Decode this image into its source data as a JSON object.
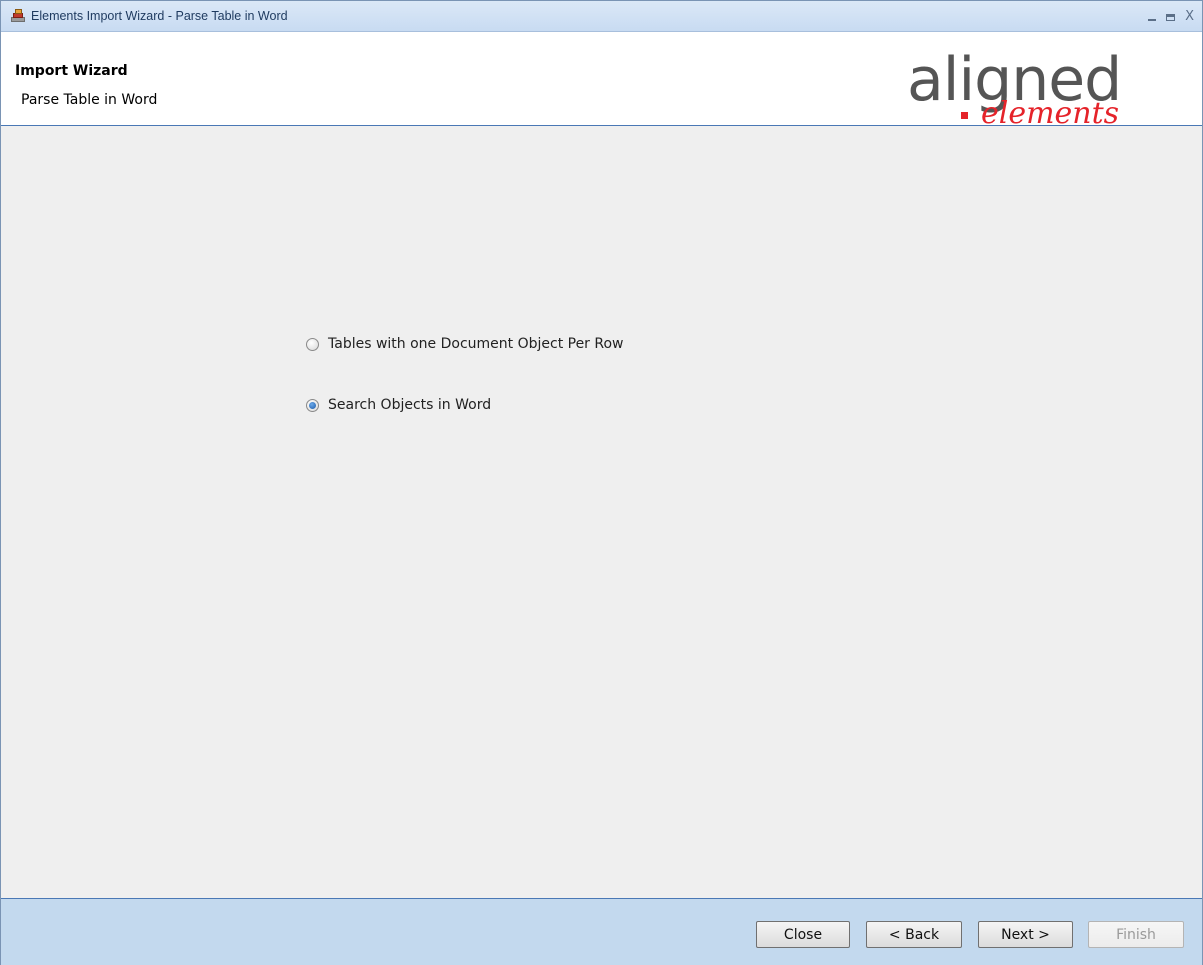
{
  "window": {
    "title": "Elements Import Wizard - Parse Table in Word",
    "controls": {
      "minimize": "_",
      "close": "X"
    }
  },
  "header": {
    "title": "Import Wizard",
    "subtitle": "Parse Table in Word",
    "logo": {
      "main": "aligned",
      "sub": "elements"
    }
  },
  "options": [
    {
      "label": "Tables with one Document Object Per Row",
      "selected": false
    },
    {
      "label": "Search Objects in Word",
      "selected": true
    }
  ],
  "footer": {
    "buttons": {
      "close": "Close",
      "back": "< Back",
      "next": "Next >",
      "finish": "Finish"
    },
    "finish_enabled": false
  },
  "colors": {
    "logo_gray": "#555555",
    "logo_red": "#e5232a",
    "chrome_blue": "#c3d9ee",
    "content_bg": "#efefef"
  }
}
